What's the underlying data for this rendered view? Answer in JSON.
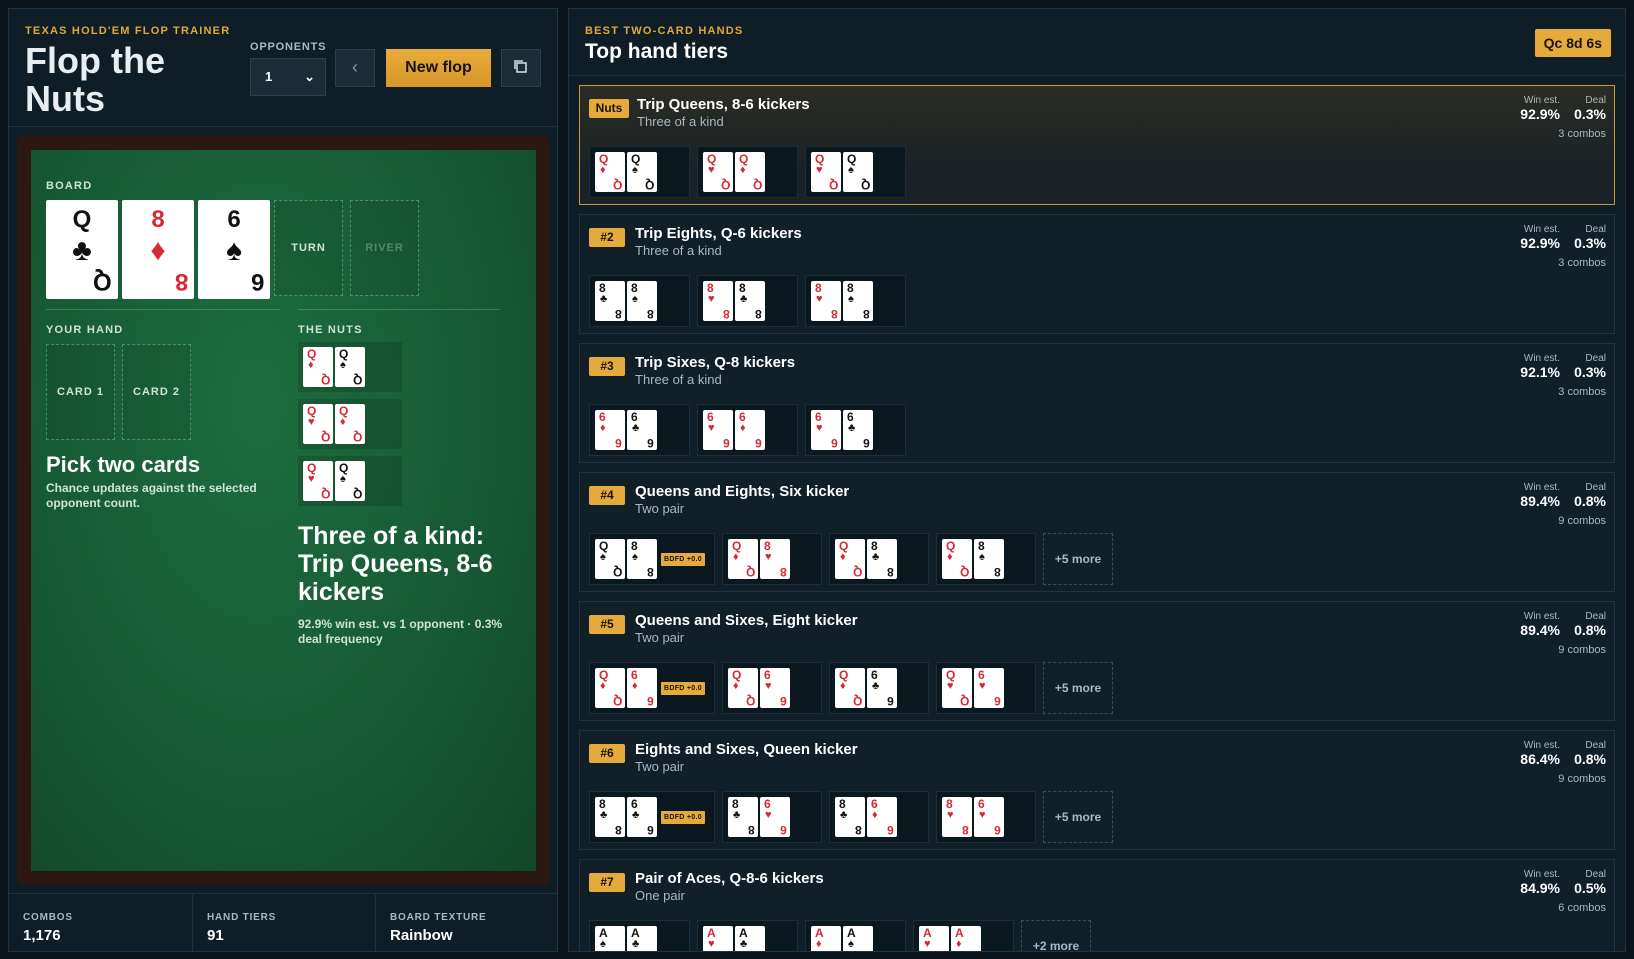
{
  "header": {
    "eyebrow": "TEXAS HOLD'EM FLOP TRAINER",
    "title": "Flop the Nuts",
    "opponents_label": "OPPONENTS",
    "opponents_value": "1",
    "new_flop": "New flop"
  },
  "board": {
    "label": "BOARD",
    "cards": [
      {
        "rank": "Q",
        "suit": "♣",
        "red": false
      },
      {
        "rank": "8",
        "suit": "♦",
        "red": true
      },
      {
        "rank": "6",
        "suit": "♠",
        "red": false
      }
    ],
    "turn": "TURN",
    "river": "RIVER"
  },
  "your_hand": {
    "label": "YOUR HAND",
    "slot1": "CARD 1",
    "slot2": "CARD 2",
    "prompt": "Pick two cards",
    "sub": "Chance updates against the selected opponent count."
  },
  "nuts": {
    "label": "THE NUTS",
    "combos": [
      [
        [
          "Q",
          "♦",
          true
        ],
        [
          "Q",
          "♠",
          false
        ]
      ],
      [
        [
          "Q",
          "♥",
          true
        ],
        [
          "Q",
          "♦",
          true
        ]
      ],
      [
        [
          "Q",
          "♥",
          true
        ],
        [
          "Q",
          "♠",
          false
        ]
      ]
    ],
    "title": "Three of a kind: Trip Queens, 8-6 kickers",
    "sub": "92.9% win est. vs 1 opponent · 0.3% deal frequency"
  },
  "stats": [
    {
      "label": "COMBOS",
      "value": "1,176"
    },
    {
      "label": "HAND TIERS",
      "value": "91"
    },
    {
      "label": "BOARD TEXTURE",
      "value": "Rainbow"
    }
  ],
  "right": {
    "eyebrow": "BEST TWO-CARD HANDS",
    "title": "Top hand tiers",
    "flop_tag": "Qc 8d 6s",
    "win_label": "Win est.",
    "deal_label": "Deal",
    "tiers": [
      {
        "badge": "Nuts",
        "name": "Trip Queens, 8-6 kickers",
        "category": "Three of a kind",
        "win": "92.9%",
        "deal": "0.3%",
        "combos_text": "3 combos",
        "combos": [
          {
            "c": [
              [
                "Q",
                "♦",
                true
              ],
              [
                "Q",
                "♠",
                false
              ]
            ]
          },
          {
            "c": [
              [
                "Q",
                "♥",
                true
              ],
              [
                "Q",
                "♦",
                true
              ]
            ]
          },
          {
            "c": [
              [
                "Q",
                "♥",
                true
              ],
              [
                "Q",
                "♠",
                false
              ]
            ]
          }
        ],
        "more": ""
      },
      {
        "badge": "#2",
        "name": "Trip Eights, Q-6 kickers",
        "category": "Three of a kind",
        "win": "92.9%",
        "deal": "0.3%",
        "combos_text": "3 combos",
        "combos": [
          {
            "c": [
              [
                "8",
                "♣",
                false
              ],
              [
                "8",
                "♠",
                false
              ]
            ]
          },
          {
            "c": [
              [
                "8",
                "♥",
                true
              ],
              [
                "8",
                "♣",
                false
              ]
            ]
          },
          {
            "c": [
              [
                "8",
                "♥",
                true
              ],
              [
                "8",
                "♠",
                false
              ]
            ]
          }
        ],
        "more": ""
      },
      {
        "badge": "#3",
        "name": "Trip Sixes, Q-8 kickers",
        "category": "Three of a kind",
        "win": "92.1%",
        "deal": "0.3%",
        "combos_text": "3 combos",
        "combos": [
          {
            "c": [
              [
                "6",
                "♦",
                true
              ],
              [
                "6",
                "♣",
                false
              ]
            ]
          },
          {
            "c": [
              [
                "6",
                "♥",
                true
              ],
              [
                "6",
                "♦",
                true
              ]
            ]
          },
          {
            "c": [
              [
                "6",
                "♥",
                true
              ],
              [
                "6",
                "♣",
                false
              ]
            ]
          }
        ],
        "more": ""
      },
      {
        "badge": "#4",
        "name": "Queens and Eights, Six kicker",
        "category": "Two pair",
        "win": "89.4%",
        "deal": "0.8%",
        "combos_text": "9 combos",
        "combos": [
          {
            "c": [
              [
                "Q",
                "♠",
                false
              ],
              [
                "8",
                "♠",
                false
              ]
            ],
            "bdfd": "BDFD +0.0"
          },
          {
            "c": [
              [
                "Q",
                "♦",
                true
              ],
              [
                "8",
                "♥",
                true
              ]
            ]
          },
          {
            "c": [
              [
                "Q",
                "♦",
                true
              ],
              [
                "8",
                "♣",
                false
              ]
            ]
          },
          {
            "c": [
              [
                "Q",
                "♦",
                true
              ],
              [
                "8",
                "♠",
                false
              ]
            ]
          }
        ],
        "more": "+5 more"
      },
      {
        "badge": "#5",
        "name": "Queens and Sixes, Eight kicker",
        "category": "Two pair",
        "win": "89.4%",
        "deal": "0.8%",
        "combos_text": "9 combos",
        "combos": [
          {
            "c": [
              [
                "Q",
                "♦",
                true
              ],
              [
                "6",
                "♦",
                true
              ]
            ],
            "bdfd": "BDFD +0.0"
          },
          {
            "c": [
              [
                "Q",
                "♦",
                true
              ],
              [
                "6",
                "♥",
                true
              ]
            ]
          },
          {
            "c": [
              [
                "Q",
                "♦",
                true
              ],
              [
                "6",
                "♣",
                false
              ]
            ]
          },
          {
            "c": [
              [
                "Q",
                "♥",
                true
              ],
              [
                "6",
                "♥",
                true
              ]
            ]
          }
        ],
        "more": "+5 more"
      },
      {
        "badge": "#6",
        "name": "Eights and Sixes, Queen kicker",
        "category": "Two pair",
        "win": "86.4%",
        "deal": "0.8%",
        "combos_text": "9 combos",
        "combos": [
          {
            "c": [
              [
                "8",
                "♣",
                false
              ],
              [
                "6",
                "♣",
                false
              ]
            ],
            "bdfd": "BDFD +0.0"
          },
          {
            "c": [
              [
                "8",
                "♣",
                false
              ],
              [
                "6",
                "♥",
                true
              ]
            ]
          },
          {
            "c": [
              [
                "8",
                "♣",
                false
              ],
              [
                "6",
                "♦",
                true
              ]
            ]
          },
          {
            "c": [
              [
                "8",
                "♥",
                true
              ],
              [
                "6",
                "♥",
                true
              ]
            ]
          }
        ],
        "more": "+5 more"
      },
      {
        "badge": "#7",
        "name": "Pair of Aces, Q-8-6 kickers",
        "category": "One pair",
        "win": "84.9%",
        "deal": "0.5%",
        "combos_text": "6 combos",
        "combos": [
          {
            "c": [
              [
                "A",
                "♠",
                false
              ],
              [
                "A",
                "♣",
                false
              ]
            ]
          },
          {
            "c": [
              [
                "A",
                "♥",
                true
              ],
              [
                "A",
                "♣",
                false
              ]
            ]
          },
          {
            "c": [
              [
                "A",
                "♦",
                true
              ],
              [
                "A",
                "♠",
                false
              ]
            ]
          },
          {
            "c": [
              [
                "A",
                "♥",
                true
              ],
              [
                "A",
                "♦",
                true
              ]
            ]
          }
        ],
        "more": "+2 more"
      }
    ]
  }
}
